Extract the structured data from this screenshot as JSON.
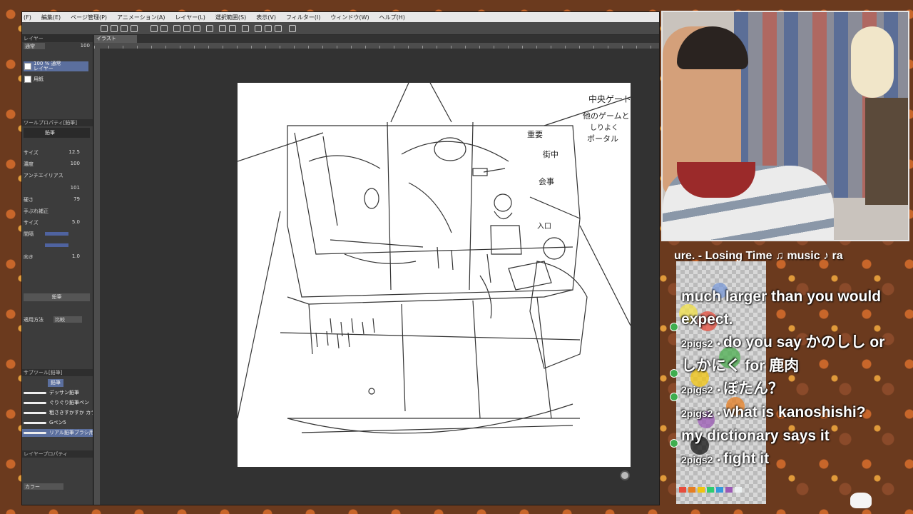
{
  "menubar": {
    "items": [
      "(F)",
      "編集(E)",
      "ページ管理(P)",
      "アニメーション(A)",
      "レイヤー(L)",
      "選択範囲(S)",
      "表示(V)",
      "フィルター(I)",
      "ウィンドウ(W)",
      "ヘルプ(H)"
    ]
  },
  "document_tab": "イラスト",
  "left_panel": {
    "layer_header": "レイヤー",
    "blend_mode": "通常",
    "opacity": "100",
    "layers": [
      {
        "line1": "100 % 通常",
        "line2": "レイヤー"
      },
      {
        "line1": "用紙",
        "line2": ""
      }
    ],
    "tool_property_header": "ツールプロパティ[鉛筆]",
    "tool_name": "鉛筆",
    "rows": [
      {
        "label": "サイズ",
        "value": "12.5"
      },
      {
        "label": "濃度",
        "value": "100"
      },
      {
        "label": "アンチエイリアス",
        "value": ""
      },
      {
        "label": "",
        "value": "101"
      },
      {
        "label": "硬さ",
        "value": "79"
      },
      {
        "label": "手ぶれ補正",
        "value": ""
      },
      {
        "label": "サイズ",
        "value": "5.0"
      },
      {
        "label": "間隔",
        "value": ""
      },
      {
        "label": "",
        "value": ""
      },
      {
        "label": "向き",
        "value": "1.0"
      }
    ],
    "pencil_label": "鉛筆",
    "mode_label": "比較",
    "apply_method": "適用方法",
    "sub_tool_header": "サブツール[鉛筆]",
    "sub_tool_tab": "鉛筆",
    "brushes": [
      "デッサン鉛筆",
      "ぐりぐり鉛筆ペン",
      "粗さきすかすか カラー",
      "Gペン5",
      "リアル鉛筆ブラシ用"
    ],
    "layer_property": "レイヤープロパティ",
    "color_label": "カラー"
  },
  "canvas": {
    "handwritten_notes": [
      "中央ゲート",
      "他のゲームと",
      "しりよく",
      "ポータル",
      "重要",
      "街中",
      "会事",
      "入口"
    ]
  },
  "now_playing": "ure. - Losing Time      ♫ music ♪ ra",
  "chat": {
    "messages": [
      {
        "user": "",
        "text": "much larger than you would expect."
      },
      {
        "user": "2pigs2",
        "text": "do you say かのしし or しかにく for 鹿肉"
      },
      {
        "user": "2pigs2",
        "text": "ぼたん？"
      },
      {
        "user": "2pigs2",
        "text": "what is kanoshishi? my dictionary says it"
      },
      {
        "user": "2pigs2",
        "text": "fight it"
      }
    ]
  },
  "colors": {
    "app_bg": "#323232",
    "menubar": "#e8e8e8",
    "selected_layer": "#5b6f9e",
    "chat_badge": "#3fae4f"
  }
}
